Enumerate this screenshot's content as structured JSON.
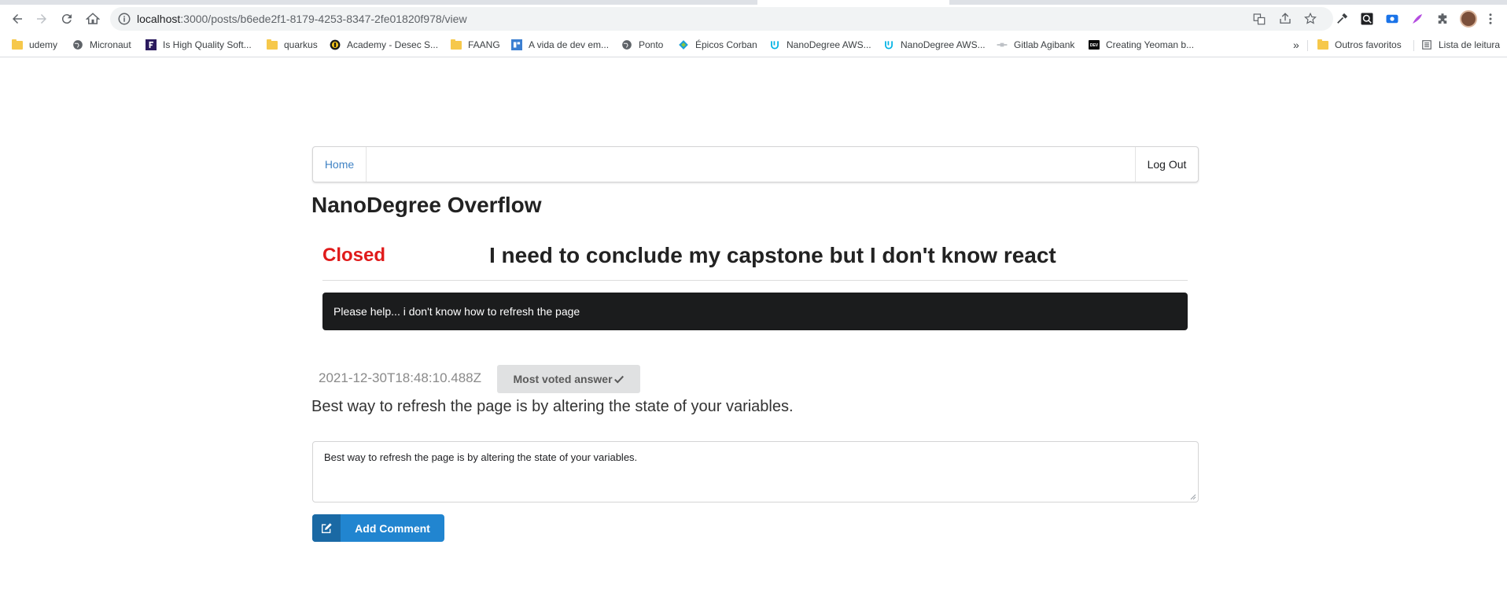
{
  "browser": {
    "url_host": "localhost",
    "url_path": ":3000/posts/b6ede2f1-8179-4253-8347-2fe01820f978/view",
    "bookmarks": [
      {
        "label": "udemy",
        "icon": "folder-icon"
      },
      {
        "label": "Micronaut",
        "icon": "globe-icon"
      },
      {
        "label": "Is High Quality Soft...",
        "icon": "site-icon"
      },
      {
        "label": "quarkus",
        "icon": "folder-icon"
      },
      {
        "label": "Academy - Desec S...",
        "icon": "site-icon"
      },
      {
        "label": "FAANG",
        "icon": "folder-icon"
      },
      {
        "label": "A vida de dev em...",
        "icon": "site-icon"
      },
      {
        "label": "Ponto",
        "icon": "globe-icon"
      },
      {
        "label": "Épicos Corban",
        "icon": "site-icon"
      },
      {
        "label": "NanoDegree AWS...",
        "icon": "udacity-icon"
      },
      {
        "label": "NanoDegree AWS...",
        "icon": "udacity-icon"
      },
      {
        "label": "Gitlab Agibank",
        "icon": "site-icon"
      },
      {
        "label": "Creating Yeoman b...",
        "icon": "dev-icon"
      }
    ],
    "overflow": "»",
    "other_bookmarks": "Outros favoritos",
    "reading_list": "Lista de leitura"
  },
  "nav": {
    "home": "Home",
    "logout": "Log Out"
  },
  "site_title": "NanoDegree Overflow",
  "post": {
    "status": "Closed",
    "title": "I need to conclude my capstone but I don't know react",
    "body": "Please help... i don't know how to refresh the page"
  },
  "answer": {
    "timestamp": "2021-12-30T18:48:10.488Z",
    "badge": "Most voted answer",
    "text": "Best way to refresh the page is by altering the state of your variables."
  },
  "comment": {
    "value": "Best way to refresh the page is by altering the state of your variables.",
    "button": "Add Comment"
  },
  "colors": {
    "status_closed": "#e01b1b",
    "primary_button": "#2185d0",
    "body_box": "#1b1c1d",
    "link": "#4183c4"
  }
}
